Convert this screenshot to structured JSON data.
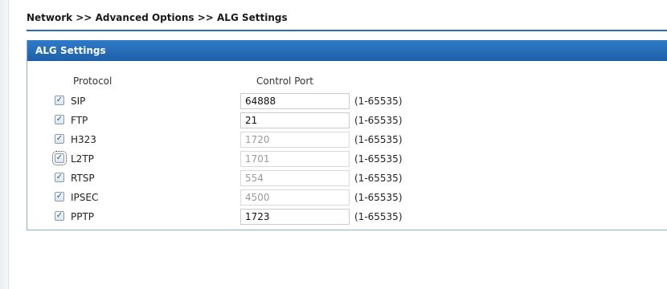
{
  "breadcrumb": "Network >> Advanced Options >> ALG Settings",
  "panel": {
    "title": "ALG Settings"
  },
  "columns": {
    "protocol": "Protocol",
    "control_port": "Control Port"
  },
  "rows": [
    {
      "name": "SIP",
      "checked": true,
      "port": "64888",
      "range": "(1-65535)",
      "disabled": false
    },
    {
      "name": "FTP",
      "checked": true,
      "port": "21",
      "range": "(1-65535)",
      "disabled": false
    },
    {
      "name": "H323",
      "checked": true,
      "port": "1720",
      "range": "(1-65535)",
      "disabled": true
    },
    {
      "name": "L2TP",
      "checked": true,
      "port": "1701",
      "range": "(1-65535)",
      "disabled": true
    },
    {
      "name": "RTSP",
      "checked": true,
      "port": "554",
      "range": "(1-65535)",
      "disabled": true
    },
    {
      "name": "IPSEC",
      "checked": true,
      "port": "4500",
      "range": "(1-65535)",
      "disabled": true
    },
    {
      "name": "PPTP",
      "checked": true,
      "port": "1723",
      "range": "(1-65535)",
      "disabled": false
    }
  ],
  "colors": {
    "header_blue": "#1e5fa8",
    "rule_blue": "#2b6cb8"
  },
  "icons": {
    "checkbox": "checkmark-icon"
  }
}
